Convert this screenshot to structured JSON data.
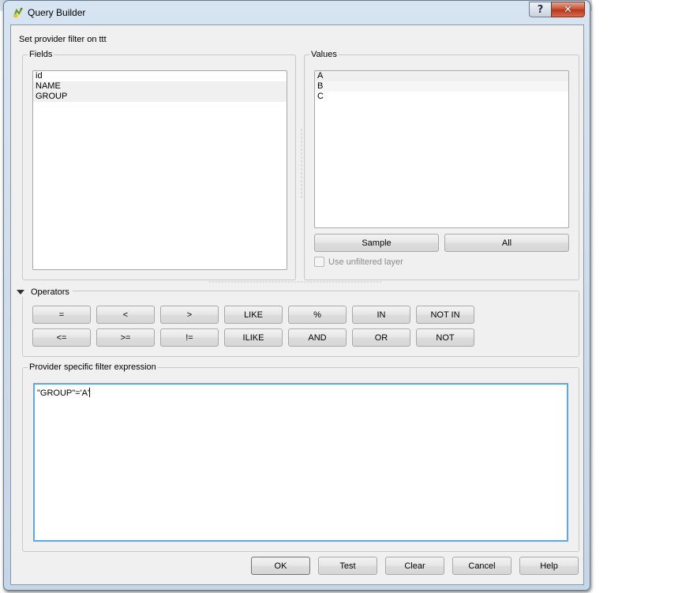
{
  "window": {
    "title": "Query Builder",
    "help_button": "?",
    "close_button": "✕"
  },
  "heading": "Set provider filter on ttt",
  "fields": {
    "label": "Fields",
    "items": [
      "id",
      "NAME",
      "GROUP"
    ]
  },
  "values": {
    "label": "Values",
    "items": [
      "A",
      "B",
      "C"
    ],
    "sample_button": "Sample",
    "all_button": "All",
    "use_unfiltered_label": "Use unfiltered layer",
    "use_unfiltered_checked": false
  },
  "operators": {
    "label": "Operators",
    "row1": [
      "=",
      "<",
      ">",
      "LIKE",
      "%",
      "IN",
      "NOT IN"
    ],
    "row2": [
      "<=",
      ">=",
      "!=",
      "ILIKE",
      "AND",
      "OR",
      "NOT"
    ]
  },
  "expression": {
    "label": "Provider specific filter expression",
    "value": "\"GROUP\"='A'"
  },
  "buttons": {
    "ok": "OK",
    "test": "Test",
    "clear": "Clear",
    "cancel": "Cancel",
    "help": "Help"
  }
}
